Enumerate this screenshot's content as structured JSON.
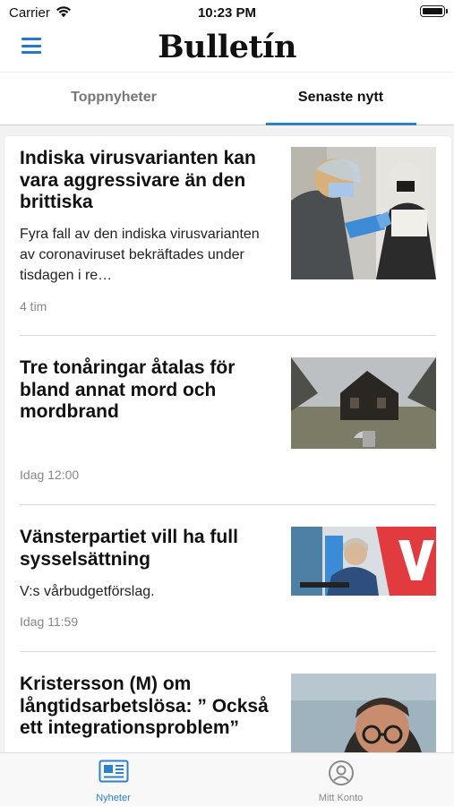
{
  "status_bar": {
    "carrier": "Carrier",
    "time": "10:23 PM"
  },
  "header": {
    "logo": "Bulletín",
    "menu_icon": "hamburger-menu-icon"
  },
  "tabs": [
    {
      "label": "Toppnyheter",
      "selected": false
    },
    {
      "label": "Senaste nytt",
      "selected": true
    }
  ],
  "articles": [
    {
      "title": "Indiska virusvarianten kan vara aggressivare än den brittiska",
      "summary": "Fyra fall av den indiska virusvarianten av coronaviruset bekräftades under tisdagen i re…",
      "time": "4 tim"
    },
    {
      "title": "Tre tonåringar åtalas för bland annat mord och mordbrand",
      "summary": "",
      "time": "Idag 12:00"
    },
    {
      "title": "Vänsterpartiet vill ha full sysselsättning",
      "summary": "V:s vårbudgetförslag.",
      "time": "Idag 11:59"
    },
    {
      "title": "Kristersson (M) om långtidsarbetslösa: ” Också ett integrationsproblem”",
      "summary": "",
      "time": ""
    }
  ],
  "tab_bar": [
    {
      "label": "Nyheter",
      "icon": "newspaper-icon",
      "selected": true
    },
    {
      "label": "Mitt Konto",
      "icon": "account-icon",
      "selected": false
    }
  ],
  "colors": {
    "accent": "#2b82c9",
    "menu": "#2577c8",
    "inactive": "#8a8a8a"
  }
}
